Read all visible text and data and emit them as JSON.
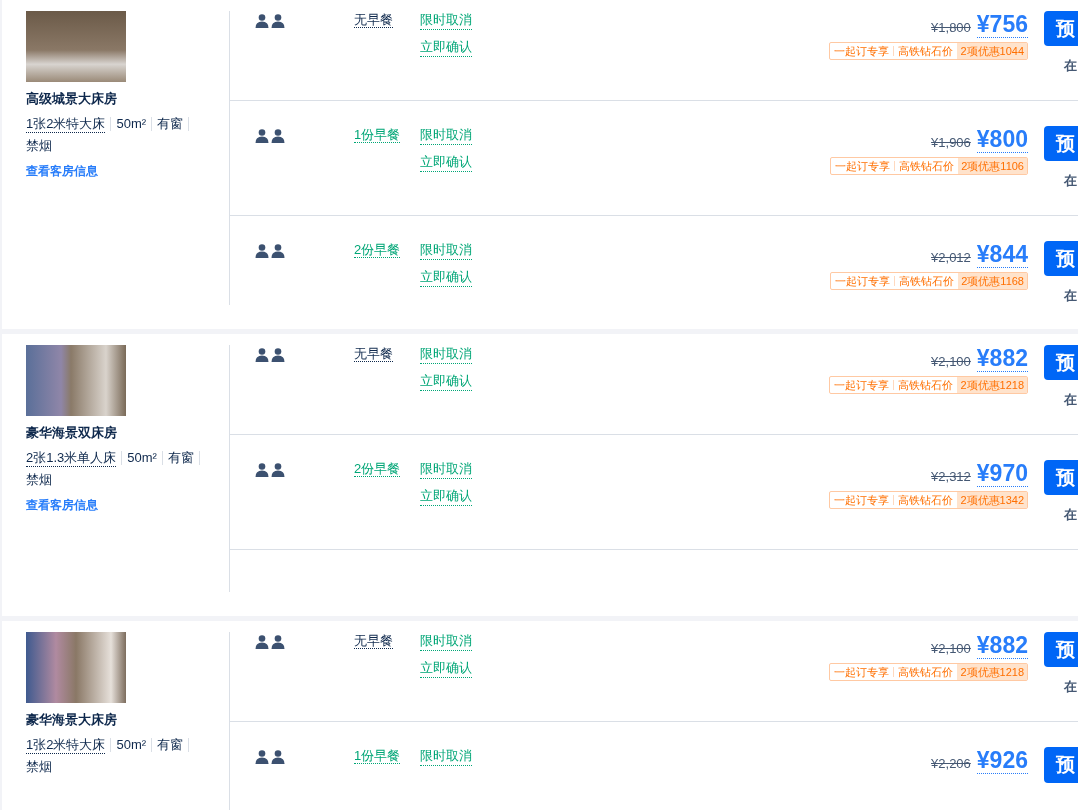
{
  "rooms": [
    {
      "name": "高级城景大床房",
      "bed": "1张2米特大床",
      "features": [
        "50m²",
        "有窗",
        "禁烟"
      ],
      "link": "查看客房信息",
      "rates": [
        {
          "kind": "offer",
          "meal": "无早餐",
          "breakfast_included": false,
          "policies": [
            "限时取消",
            "立即确认"
          ],
          "original_price": "¥1,800",
          "price": "¥756",
          "tags": [
            "一起订专享",
            "高铁钻石价"
          ],
          "discount": "2项优惠1044",
          "book": "预",
          "note": "在"
        },
        {
          "kind": "offer",
          "meal": "1份早餐",
          "breakfast_included": true,
          "policies": [
            "限时取消",
            "立即确认"
          ],
          "original_price": "¥1,906",
          "price": "¥800",
          "tags": [
            "一起订专享",
            "高铁钻石价"
          ],
          "discount": "2项优惠1106",
          "book": "预",
          "note": "在"
        },
        {
          "kind": "offer",
          "meal": "2份早餐",
          "breakfast_included": true,
          "policies": [
            "限时取消",
            "立即确认"
          ],
          "original_price": "¥2,012",
          "price": "¥844",
          "tags": [
            "一起订专享",
            "高铁钻石价"
          ],
          "discount": "2项优惠1168",
          "book": "预",
          "note": "在"
        }
      ]
    },
    {
      "name": "豪华海景双床房",
      "bed": "2张1.3米单人床",
      "features": [
        "50m²",
        "有窗",
        "禁烟"
      ],
      "link": "查看客房信息",
      "rates": [
        {
          "kind": "offer",
          "meal": "无早餐",
          "breakfast_included": false,
          "policies": [
            "限时取消",
            "立即确认"
          ],
          "original_price": "¥2,100",
          "price": "¥882",
          "tags": [
            "一起订专享",
            "高铁钻石价"
          ],
          "discount": "2项优惠1218",
          "book": "预",
          "note": "在"
        },
        {
          "kind": "offer",
          "meal": "2份早餐",
          "breakfast_included": true,
          "policies": [
            "限时取消",
            "立即确认"
          ],
          "original_price": "¥2,312",
          "price": "¥970",
          "tags": [
            "一起订专享",
            "高铁钻石价"
          ],
          "discount": "2项优惠1342",
          "book": "预",
          "note": "在"
        },
        {
          "kind": "empty"
        }
      ]
    },
    {
      "name": "豪华海景大床房",
      "bed": "1张2米特大床",
      "features": [
        "50m²",
        "有窗",
        "禁烟"
      ],
      "rates": [
        {
          "kind": "offer",
          "meal": "无早餐",
          "breakfast_included": false,
          "policies": [
            "限时取消",
            "立即确认"
          ],
          "original_price": "¥2,100",
          "price": "¥882",
          "tags": [
            "一起订专享",
            "高铁钻石价"
          ],
          "discount": "2项优惠1218",
          "book": "预",
          "note": "在"
        },
        {
          "kind": "offer",
          "meal": "1份早餐",
          "breakfast_included": true,
          "policies": [
            "限时取消"
          ],
          "original_price": "¥2,206",
          "price": "¥926",
          "book": "预"
        }
      ]
    }
  ]
}
